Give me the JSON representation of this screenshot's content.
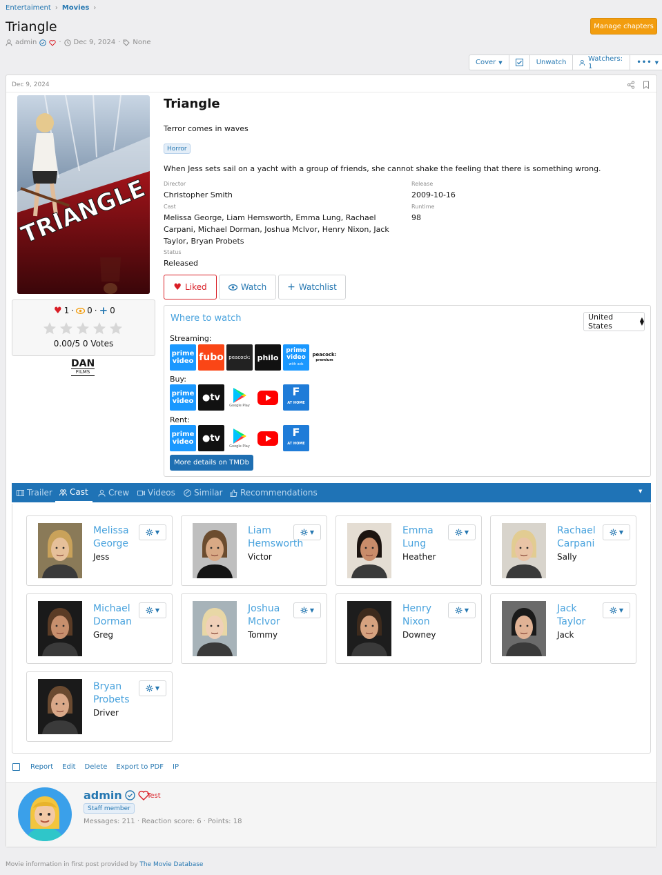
{
  "breadcrumb": [
    "Entertaiment",
    "Movies"
  ],
  "page_title": "Triangle",
  "meta": {
    "author": "admin",
    "date": "Dec 9, 2024",
    "tags": "None"
  },
  "manage_chapters": "Manage chapters",
  "toolbar": {
    "cover": "Cover",
    "unwatch": "Unwatch",
    "watchers": "Watchers: 1"
  },
  "post": {
    "date": "Dec 9, 2024",
    "poster_text": "TRIANGLE",
    "likes": "1",
    "watching": "0",
    "watchlist": "0",
    "votes": "0.00/5 0 Votes",
    "studio_logo": {
      "line1": "DAN",
      "line2": "FILMS"
    },
    "title": "Triangle",
    "tagline": "Terror comes in waves",
    "genre": "Horror",
    "overview": "When Jess sets sail on a yacht with a group of friends, she cannot shake the feeling that there is something wrong.",
    "director_label": "Director",
    "director": "Christopher Smith",
    "release_label": "Release",
    "release": "2009-10-16",
    "cast_label": "Cast",
    "cast_list": "Melissa George, Liam Hemsworth, Emma Lung, Rachael Carpani, Michael Dorman, Joshua McIvor, Henry Nixon, Jack Taylor, Bryan Probets",
    "runtime_label": "Runtime",
    "runtime": "98",
    "status_label": "Status",
    "status": "Released",
    "btn_liked": "Liked",
    "btn_watch": "Watch",
    "btn_watchlist": "Watchlist"
  },
  "where_to_watch": {
    "title": "Where to watch",
    "country": "United States",
    "streaming_label": "Streaming:",
    "buy_label": "Buy:",
    "rent_label": "Rent:",
    "streaming": [
      "prime video",
      "fubo",
      "peacock",
      "philo",
      "prime video with ads",
      "peacock premium"
    ],
    "buy": [
      "prime video",
      "tv",
      "Google Play",
      "YouTube",
      "AT HOME"
    ],
    "rent": [
      "prime video",
      "tv",
      "Google Play",
      "YouTube",
      "AT HOME"
    ],
    "more_details": "More details on TMDb"
  },
  "tabs": [
    "Trailer",
    "Cast",
    "Crew",
    "Videos",
    "Similar",
    "Recommendations"
  ],
  "cast": [
    {
      "name": "Melissa George",
      "role": "Jess"
    },
    {
      "name": "Liam Hemsworth",
      "role": "Victor"
    },
    {
      "name": "Emma Lung",
      "role": "Heather"
    },
    {
      "name": "Rachael Carpani",
      "role": "Sally"
    },
    {
      "name": "Michael Dorman",
      "role": "Greg"
    },
    {
      "name": "Joshua McIvor",
      "role": "Tommy"
    },
    {
      "name": "Henry Nixon",
      "role": "Downey"
    },
    {
      "name": "Jack Taylor",
      "role": "Jack"
    },
    {
      "name": "Bryan Probets",
      "role": "Driver"
    }
  ],
  "post_actions": [
    "Report",
    "Edit",
    "Delete",
    "Export to PDF",
    "IP"
  ],
  "user": {
    "name": "admin",
    "title": "Test",
    "badge": "Staff member",
    "stats": "Messages: 211 · Reaction score: 6 · Points: 18"
  },
  "footer": {
    "text": "Movie information in first post provided by ",
    "link": "The Movie Database"
  }
}
